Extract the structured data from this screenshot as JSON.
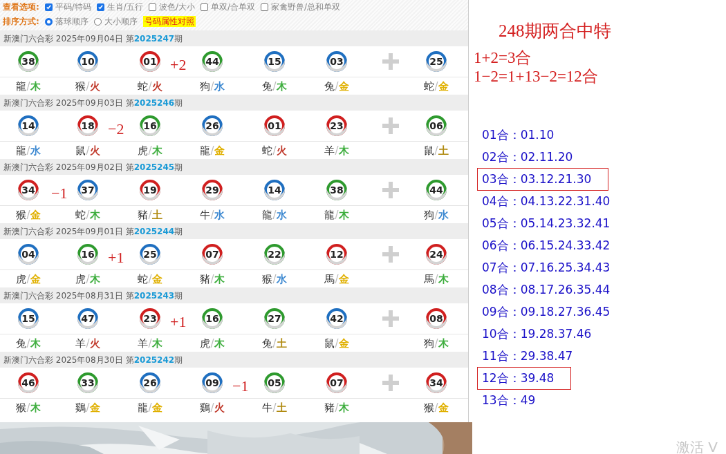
{
  "options": {
    "view_label": "查看选项:",
    "view_options": [
      {
        "label": "平码/特码",
        "checked": true
      },
      {
        "label": "生肖/五行",
        "checked": true
      },
      {
        "label": "波色/大小",
        "checked": false
      },
      {
        "label": "单双/合单双",
        "checked": false
      },
      {
        "label": "家禽野兽/总和单双",
        "checked": false
      }
    ],
    "sort_label": "排序方式:",
    "sort_options": [
      {
        "label": "落球顺序",
        "selected": true
      },
      {
        "label": "大小顺序",
        "selected": false
      }
    ],
    "compare_button": "号码属性对照"
  },
  "separator": "/",
  "draws": [
    {
      "title": "新澳门六合彩 2025年09月04日 第",
      "issue": "2025247",
      "suffix": "期",
      "balls": [
        {
          "number": "38",
          "color": "#2e9a2e",
          "zodiac": "龍",
          "element": {
            "text": "木",
            "color": "#3fae3f"
          }
        },
        {
          "number": "10",
          "color": "#1f6fc0",
          "zodiac": "猴",
          "element": {
            "text": "火",
            "color": "#c0392b"
          }
        },
        {
          "number": "01",
          "color": "#d01f1f",
          "zodiac": "蛇",
          "element": {
            "text": "火",
            "color": "#c0392b"
          },
          "note": "+2"
        },
        {
          "number": "44",
          "color": "#2e9a2e",
          "zodiac": "狗",
          "element": {
            "text": "水",
            "color": "#3a87d0"
          }
        },
        {
          "number": "15",
          "color": "#1f6fc0",
          "zodiac": "兔",
          "element": {
            "text": "木",
            "color": "#3fae3f"
          }
        },
        {
          "number": "03",
          "color": "#1f6fc0",
          "zodiac": "兔",
          "element": {
            "text": "金",
            "color": "#e0b000"
          }
        },
        {
          "number": "25",
          "color": "#1f6fc0",
          "zodiac": "蛇",
          "element": {
            "text": "金",
            "color": "#e0b000"
          }
        }
      ]
    },
    {
      "title": "新澳门六合彩 2025年09月03日 第",
      "issue": "2025246",
      "suffix": "期",
      "balls": [
        {
          "number": "14",
          "color": "#1f6fc0",
          "zodiac": "龍",
          "element": {
            "text": "水",
            "color": "#3a87d0"
          }
        },
        {
          "number": "18",
          "color": "#d01f1f",
          "zodiac": "鼠",
          "element": {
            "text": "火",
            "color": "#c0392b"
          },
          "note": "−2"
        },
        {
          "number": "16",
          "color": "#2e9a2e",
          "zodiac": "虎",
          "element": {
            "text": "木",
            "color": "#3fae3f"
          }
        },
        {
          "number": "26",
          "color": "#1f6fc0",
          "zodiac": "龍",
          "element": {
            "text": "金",
            "color": "#e0b000"
          }
        },
        {
          "number": "01",
          "color": "#d01f1f",
          "zodiac": "蛇",
          "element": {
            "text": "火",
            "color": "#c0392b"
          }
        },
        {
          "number": "23",
          "color": "#d01f1f",
          "zodiac": "羊",
          "element": {
            "text": "木",
            "color": "#3fae3f"
          }
        },
        {
          "number": "06",
          "color": "#2e9a2e",
          "zodiac": "鼠",
          "element": {
            "text": "土",
            "color": "#b08a10"
          }
        }
      ]
    },
    {
      "title": "新澳门六合彩 2025年09月02日 第",
      "issue": "2025245",
      "suffix": "期",
      "balls": [
        {
          "number": "34",
          "color": "#d01f1f",
          "zodiac": "猴",
          "element": {
            "text": "金",
            "color": "#e0b000"
          },
          "note": "−1"
        },
        {
          "number": "37",
          "color": "#1f6fc0",
          "zodiac": "蛇",
          "element": {
            "text": "木",
            "color": "#3fae3f"
          }
        },
        {
          "number": "19",
          "color": "#d01f1f",
          "zodiac": "豬",
          "element": {
            "text": "土",
            "color": "#b08a10"
          }
        },
        {
          "number": "29",
          "color": "#d01f1f",
          "zodiac": "牛",
          "element": {
            "text": "水",
            "color": "#3a87d0"
          }
        },
        {
          "number": "14",
          "color": "#1f6fc0",
          "zodiac": "龍",
          "element": {
            "text": "水",
            "color": "#3a87d0"
          }
        },
        {
          "number": "38",
          "color": "#2e9a2e",
          "zodiac": "龍",
          "element": {
            "text": "木",
            "color": "#3fae3f"
          }
        },
        {
          "number": "44",
          "color": "#2e9a2e",
          "zodiac": "狗",
          "element": {
            "text": "水",
            "color": "#3a87d0"
          }
        }
      ]
    },
    {
      "title": "新澳门六合彩 2025年09月01日 第",
      "issue": "2025244",
      "suffix": "期",
      "balls": [
        {
          "number": "04",
          "color": "#1f6fc0",
          "zodiac": "虎",
          "element": {
            "text": "金",
            "color": "#e0b000"
          }
        },
        {
          "number": "16",
          "color": "#2e9a2e",
          "zodiac": "虎",
          "element": {
            "text": "木",
            "color": "#3fae3f"
          },
          "note": "+1"
        },
        {
          "number": "25",
          "color": "#1f6fc0",
          "zodiac": "蛇",
          "element": {
            "text": "金",
            "color": "#e0b000"
          }
        },
        {
          "number": "07",
          "color": "#d01f1f",
          "zodiac": "豬",
          "element": {
            "text": "木",
            "color": "#3fae3f"
          }
        },
        {
          "number": "22",
          "color": "#2e9a2e",
          "zodiac": "猴",
          "element": {
            "text": "水",
            "color": "#3a87d0"
          }
        },
        {
          "number": "12",
          "color": "#d01f1f",
          "zodiac": "馬",
          "element": {
            "text": "金",
            "color": "#e0b000"
          }
        },
        {
          "number": "24",
          "color": "#d01f1f",
          "zodiac": "馬",
          "element": {
            "text": "木",
            "color": "#3fae3f"
          }
        }
      ]
    },
    {
      "title": "新澳门六合彩 2025年08月31日 第",
      "issue": "2025243",
      "suffix": "期",
      "balls": [
        {
          "number": "15",
          "color": "#1f6fc0",
          "zodiac": "兔",
          "element": {
            "text": "木",
            "color": "#3fae3f"
          }
        },
        {
          "number": "47",
          "color": "#1f6fc0",
          "zodiac": "羊",
          "element": {
            "text": "火",
            "color": "#c0392b"
          }
        },
        {
          "number": "23",
          "color": "#d01f1f",
          "zodiac": "羊",
          "element": {
            "text": "木",
            "color": "#3fae3f"
          },
          "note": "+1"
        },
        {
          "number": "16",
          "color": "#2e9a2e",
          "zodiac": "虎",
          "element": {
            "text": "木",
            "color": "#3fae3f"
          }
        },
        {
          "number": "27",
          "color": "#2e9a2e",
          "zodiac": "兔",
          "element": {
            "text": "土",
            "color": "#b08a10"
          }
        },
        {
          "number": "42",
          "color": "#1f6fc0",
          "zodiac": "鼠",
          "element": {
            "text": "金",
            "color": "#e0b000"
          }
        },
        {
          "number": "08",
          "color": "#d01f1f",
          "zodiac": "狗",
          "element": {
            "text": "木",
            "color": "#3fae3f"
          }
        }
      ]
    },
    {
      "title": "新澳门六合彩 2025年08月30日 第",
      "issue": "2025242",
      "suffix": "期",
      "balls": [
        {
          "number": "46",
          "color": "#d01f1f",
          "zodiac": "猴",
          "element": {
            "text": "木",
            "color": "#3fae3f"
          }
        },
        {
          "number": "33",
          "color": "#2e9a2e",
          "zodiac": "鷄",
          "element": {
            "text": "金",
            "color": "#e0b000"
          }
        },
        {
          "number": "26",
          "color": "#1f6fc0",
          "zodiac": "龍",
          "element": {
            "text": "金",
            "color": "#e0b000"
          }
        },
        {
          "number": "09",
          "color": "#1f6fc0",
          "zodiac": "鷄",
          "element": {
            "text": "火",
            "color": "#c0392b"
          },
          "note": "−1"
        },
        {
          "number": "05",
          "color": "#2e9a2e",
          "zodiac": "牛",
          "element": {
            "text": "土",
            "color": "#b08a10"
          }
        },
        {
          "number": "07",
          "color": "#d01f1f",
          "zodiac": "豬",
          "element": {
            "text": "木",
            "color": "#3fae3f"
          }
        },
        {
          "number": "34",
          "color": "#d01f1f",
          "zodiac": "猴",
          "element": {
            "text": "金",
            "color": "#e0b000"
          }
        }
      ]
    }
  ],
  "notes": {
    "title": "248期两合中特",
    "lines": [
      "1+2=3合",
      "1−2=1+13−2=12合"
    ]
  },
  "sum_groups": [
    {
      "label": "01合：",
      "numbers": "01.10",
      "boxed": false
    },
    {
      "label": "02合：",
      "numbers": "02.11.20",
      "boxed": false
    },
    {
      "label": "03合：",
      "numbers": "03.12.21.30",
      "boxed": true
    },
    {
      "label": "04合：",
      "numbers": "04.13.22.31.40",
      "boxed": false
    },
    {
      "label": "05合：",
      "numbers": "05.14.23.32.41",
      "boxed": false
    },
    {
      "label": "06合：",
      "numbers": "06.15.24.33.42",
      "boxed": false
    },
    {
      "label": "07合：",
      "numbers": "07.16.25.34.43",
      "boxed": false
    },
    {
      "label": "08合：",
      "numbers": "08.17.26.35.44",
      "boxed": false
    },
    {
      "label": "09合：",
      "numbers": "09.18.27.36.45",
      "boxed": false
    },
    {
      "label": "10合：",
      "numbers": "19.28.37.46",
      "boxed": false
    },
    {
      "label": "11合：",
      "numbers": "29.38.47",
      "boxed": false
    },
    {
      "label": "12合：",
      "numbers": "39.48",
      "boxed": true
    },
    {
      "label": "13合：",
      "numbers": "49",
      "boxed": false
    }
  ],
  "watermark": "激活 V"
}
